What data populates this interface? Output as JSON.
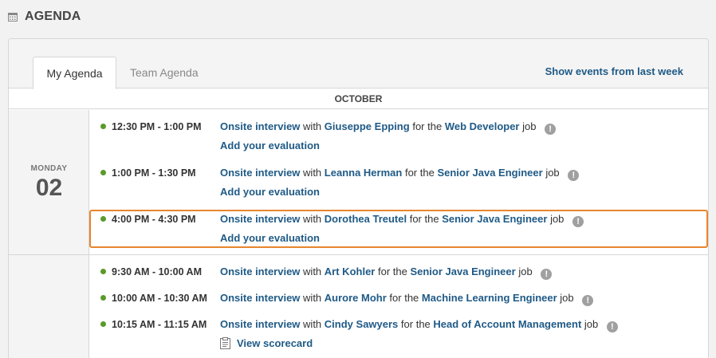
{
  "header": {
    "title": "AGENDA",
    "icon": "calendar-icon"
  },
  "tabs": [
    {
      "label": "My Agenda",
      "active": true
    },
    {
      "label": "Team Agenda",
      "active": false
    }
  ],
  "show_last_week": "Show events from last week",
  "month": "OCTOBER",
  "days": [
    {
      "weekday": "MONDAY",
      "day": "02",
      "events": [
        {
          "time": "12:30 PM - 1:00 PM",
          "event_type": "Onsite interview",
          "with_text": "with",
          "candidate": "Giuseppe Epping",
          "for_text": "for the",
          "job": "Web Developer",
          "job_text": "job",
          "action": "Add your evaluation"
        },
        {
          "time": "1:00 PM - 1:30 PM",
          "event_type": "Onsite interview",
          "with_text": "with",
          "candidate": "Leanna Herman",
          "for_text": "for the",
          "job": "Senior Java Engineer",
          "job_text": "job",
          "action": "Add your evaluation"
        },
        {
          "time": "4:00 PM - 4:30 PM",
          "event_type": "Onsite interview",
          "with_text": "with",
          "candidate": "Dorothea Treutel",
          "for_text": "for the",
          "job": "Senior Java Engineer",
          "job_text": "job",
          "action": "Add your evaluation"
        }
      ]
    },
    {
      "weekday": "",
      "day": "",
      "events": [
        {
          "time": "9:30 AM - 10:00 AM",
          "event_type": "Onsite interview",
          "with_text": "with",
          "candidate": "Art Kohler",
          "for_text": "for the",
          "job": "Senior Java Engineer",
          "job_text": "job"
        },
        {
          "time": "10:00 AM - 10:30 AM",
          "event_type": "Onsite interview",
          "with_text": "with",
          "candidate": "Aurore Mohr",
          "for_text": "for the",
          "job": "Machine Learning Engineer",
          "job_text": "job"
        },
        {
          "time": "10:15 AM - 11:15 AM",
          "event_type": "Onsite interview",
          "with_text": "with",
          "candidate": "Cindy Sawyers",
          "for_text": "for the",
          "job": "Head of Account Management",
          "job_text": "job",
          "action": "View scorecard"
        }
      ]
    }
  ],
  "info_glyph": "!",
  "colors": {
    "link": "#1f5a86",
    "status_dot": "#5a9a2a",
    "highlight": "#e8862f"
  }
}
